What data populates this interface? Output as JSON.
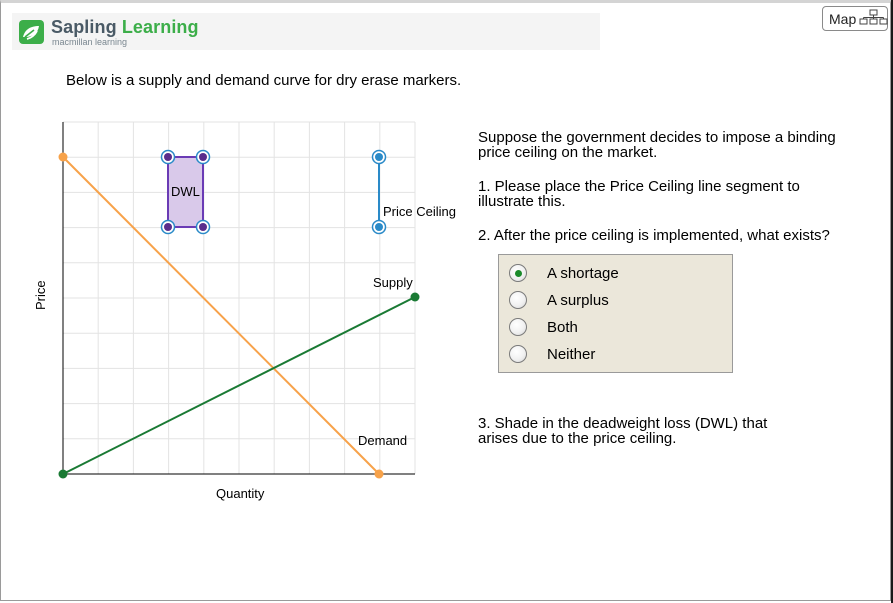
{
  "header": {
    "brand_main": "Sapling ",
    "brand_accent": "Learning",
    "brand_sub": "macmillan learning",
    "map_label": "Map"
  },
  "intro": "Below is a supply and demand curve for dry erase markers.",
  "graph": {
    "x_axis_label": "Quantity",
    "y_axis_label": "Price",
    "dwl_label": "DWL",
    "price_ceiling_label": "Price Ceiling",
    "supply_label": "Supply",
    "demand_label": "Demand",
    "colors": {
      "supply": "#1a7a34",
      "demand": "#f7a24a",
      "dwl_fill": "#d9c9ea",
      "dwl_stroke": "#6a3bb5",
      "dwl_handle": "#5a2d8c",
      "ceiling": "#2a8ac8",
      "grid": "#e3e3e3",
      "axis": "#000000"
    }
  },
  "questions": {
    "intro": "Suppose the government decides to impose a binding\nprice ceiling on the market.",
    "q1": "1. Please place the Price Ceiling line segment to\nillustrate this.",
    "q2": "2. After the price ceiling is implemented, what exists?",
    "q3": "3. Shade in the deadweight loss (DWL) that\narises due to the price ceiling."
  },
  "options": [
    {
      "label": "A shortage",
      "selected": true
    },
    {
      "label": "A surplus",
      "selected": false
    },
    {
      "label": "Both",
      "selected": false
    },
    {
      "label": "Neither",
      "selected": false
    }
  ]
}
